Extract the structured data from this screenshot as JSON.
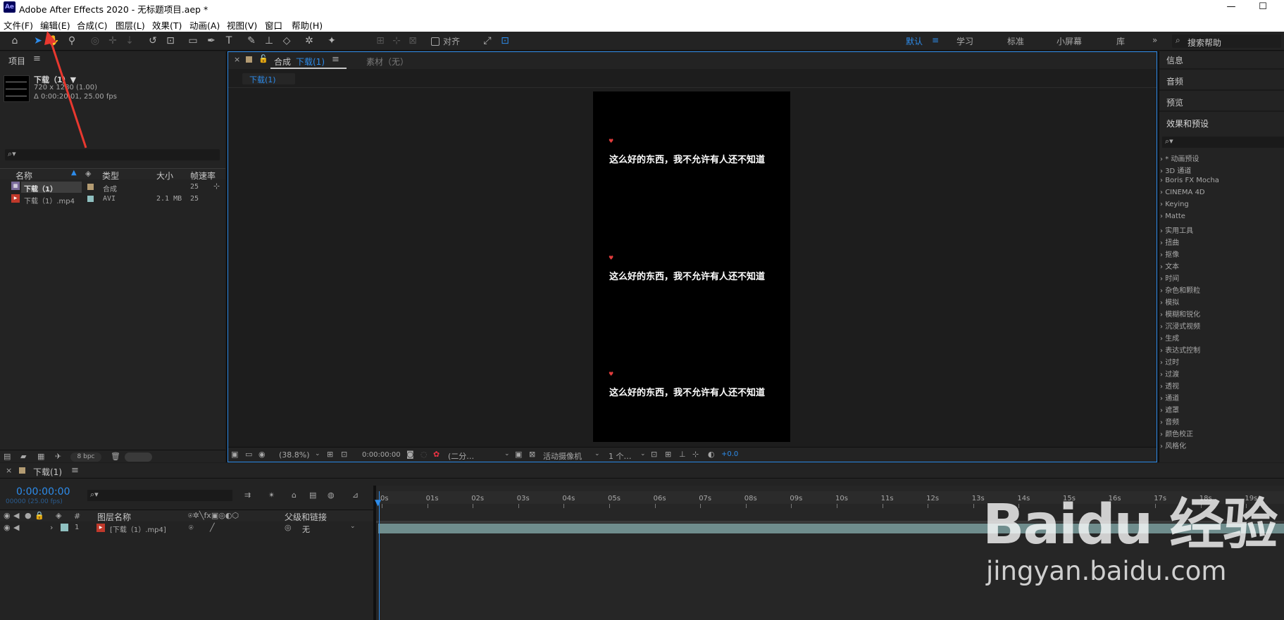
{
  "window": {
    "title": "Adobe After Effects 2020 - 无标题项目.aep *",
    "logo": "Ae",
    "minimize": "—",
    "maximize": "☐"
  },
  "menu": [
    "文件(F)",
    "编辑(E)",
    "合成(C)",
    "图层(L)",
    "效果(T)",
    "动画(A)",
    "视图(V)",
    "窗口",
    "帮助(H)"
  ],
  "toolbar": {
    "snap_label": "对齐",
    "workspaces": [
      "默认",
      "学习",
      "标准",
      "小屏幕",
      "库"
    ],
    "search_placeholder": "搜索帮助"
  },
  "project": {
    "title": "项目",
    "item": {
      "name": "下载（1）▼",
      "res": "720 x 1280 (1.00)",
      "duration": "Δ 0:00:20:01, 25.00 fps"
    },
    "search_icon": "⌕▾",
    "columns": [
      "名称",
      "类型",
      "大小",
      "帧速率"
    ],
    "rows": [
      {
        "name": "下载（1）",
        "type": "合成",
        "size": "",
        "fps": "25",
        "color": "#b39b72"
      },
      {
        "name": "下载（1）.mp4",
        "type": "AVI",
        "size": "2.1 MB",
        "fps": "25",
        "color": "#8fc0c0"
      }
    ],
    "bpc": "8 bpc"
  },
  "composition": {
    "tab_prefix": "合成",
    "tab_name": "下载(1)",
    "footage_tab": "素材（无）",
    "breadcrumb": "下载(1)",
    "captions": [
      "这么好的东西，我不允许有人还不知道",
      "这么好的东西，我不允许有人还不知道",
      "这么好的东西，我不允许有人还不知道"
    ],
    "zoom": "(38.8%)",
    "timecode": "0:00:00:00",
    "resolution": "(二分…",
    "camera": "活动摄像机",
    "views": "1 个…",
    "exposure": "+0.0"
  },
  "right_panel": {
    "tabs": [
      "信息",
      "音频",
      "预览",
      "效果和预设"
    ],
    "effects": [
      "* 动画预设",
      "3D 通道",
      "Boris FX Mocha",
      "CINEMA 4D",
      "Keying",
      "Matte",
      "实用工具",
      "扭曲",
      "抠像",
      "文本",
      "时间",
      "杂色和颗粒",
      "模拟",
      "模糊和锐化",
      "沉浸式视频",
      "生成",
      "表达式控制",
      "过时",
      "过渡",
      "透视",
      "通道",
      "遮罩",
      "音频",
      "颜色校正",
      "风格化"
    ]
  },
  "timeline": {
    "tab_name": "下载(1)",
    "timecode": "0:00:00:00",
    "frame_info": "00000 (25.00 fps)",
    "col_layer_name": "图层名称",
    "col_parent": "父级和链接",
    "col_num": "#",
    "layer": {
      "num": "1",
      "name": "[下载（1）.mp4]",
      "parent": "无"
    },
    "ruler": [
      "0s",
      "01s",
      "02s",
      "03s",
      "04s",
      "05s",
      "06s",
      "07s",
      "08s",
      "09s",
      "10s",
      "11s",
      "12s",
      "13s",
      "14s",
      "15s",
      "16s",
      "17s",
      "18s",
      "19s"
    ]
  },
  "watermark": {
    "brand": "Baidu 经验",
    "url": "jingyan.baidu.com"
  },
  "colors": {
    "accent": "#2d8ceb",
    "panel": "#232323",
    "bg": "#1d1d1d",
    "annotation_arrow": "#e8382f",
    "layer_bar": "#6f8d8d"
  }
}
